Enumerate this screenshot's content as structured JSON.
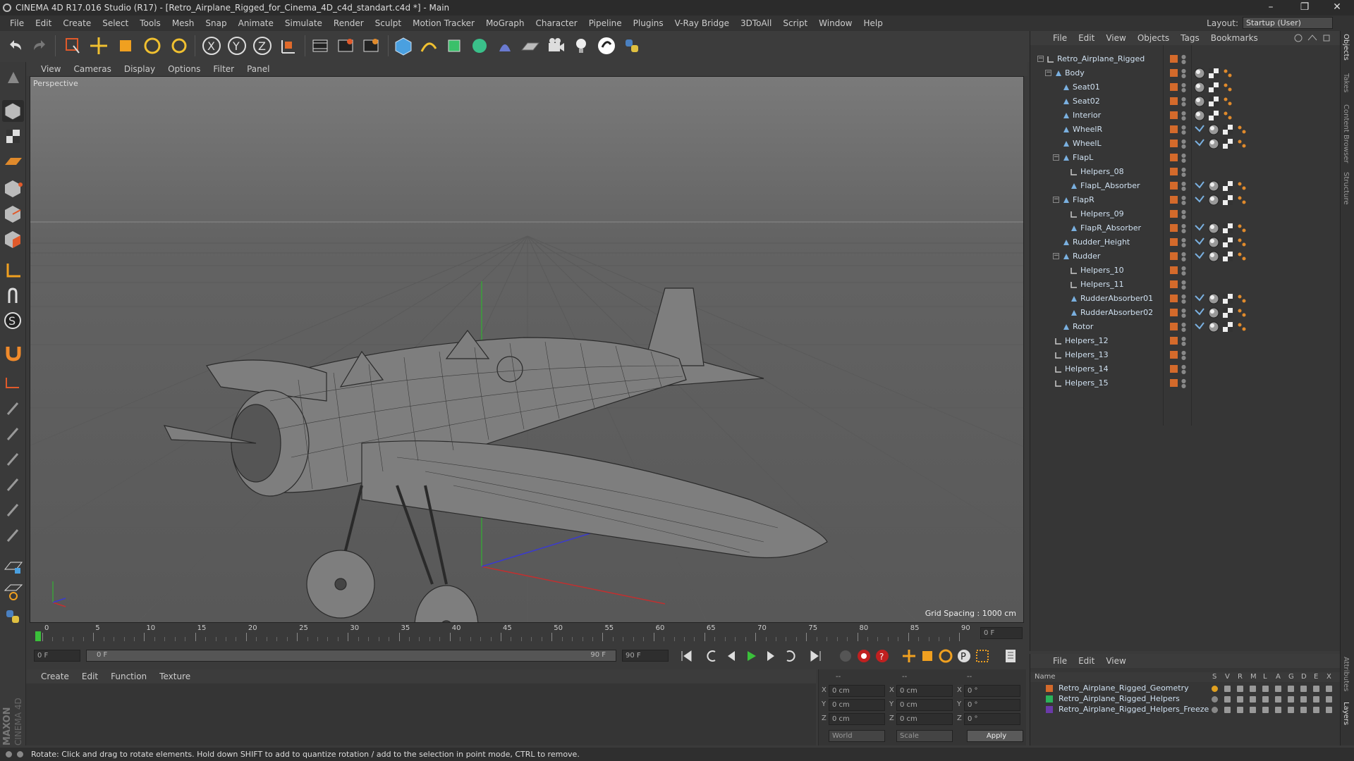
{
  "window": {
    "title": "CINEMA 4D R17.016 Studio (R17) - [Retro_Airplane_Rigged_for_Cinema_4D_c4d_standart.c4d *] - Main",
    "controls": [
      "–",
      "❐",
      "✕"
    ]
  },
  "menubar": [
    "File",
    "Edit",
    "Create",
    "Select",
    "Tools",
    "Mesh",
    "Snap",
    "Animate",
    "Simulate",
    "Render",
    "Sculpt",
    "Motion Tracker",
    "MoGraph",
    "Character",
    "Pipeline",
    "Plugins",
    "V-Ray Bridge",
    "3DToAll",
    "Script",
    "Window",
    "Help"
  ],
  "layout": {
    "label": "Layout:",
    "value": "Startup (User)"
  },
  "viewport": {
    "menu": [
      "View",
      "Cameras",
      "Display",
      "Options",
      "Filter",
      "Panel"
    ],
    "label": "Perspective",
    "grid_spacing": "Grid Spacing : 1000 cm"
  },
  "timeline": {
    "ticks": [
      "0",
      "5",
      "10",
      "15",
      "20",
      "25",
      "30",
      "35",
      "40",
      "45",
      "50",
      "55",
      "60",
      "65",
      "70",
      "75",
      "80",
      "85",
      "90"
    ],
    "end_field": "0 F",
    "start_field": "0 F",
    "range_start": "0 F",
    "range_end": "90 F",
    "max_field": "90 F"
  },
  "material_menu": [
    "Create",
    "Edit",
    "Function",
    "Texture"
  ],
  "coords": {
    "header": [
      "--",
      "--",
      "--"
    ],
    "rows": [
      {
        "axis": "X",
        "pos": "0 cm",
        "axis2": "X",
        "size": "0 cm",
        "axis3": "X",
        "rot": "0 °"
      },
      {
        "axis": "Y",
        "pos": "0 cm",
        "axis2": "Y",
        "size": "0 cm",
        "axis3": "Y",
        "rot": "0 °"
      },
      {
        "axis": "Z",
        "pos": "0 cm",
        "axis2": "Z",
        "size": "0 cm",
        "axis3": "Z",
        "rot": "0 °"
      }
    ],
    "world": "World",
    "scale": "Scale",
    "apply": "Apply"
  },
  "object_menu": [
    "File",
    "Edit",
    "View",
    "Objects",
    "Tags",
    "Bookmarks"
  ],
  "objects": [
    {
      "name": "Retro_Airplane_Rigged",
      "depth": 0,
      "type": "null",
      "tags": 0
    },
    {
      "name": "Body",
      "depth": 1,
      "type": "joint",
      "tags": 3
    },
    {
      "name": "Seat01",
      "depth": 2,
      "type": "joint",
      "tags": 3
    },
    {
      "name": "Seat02",
      "depth": 2,
      "type": "joint",
      "tags": 3
    },
    {
      "name": "Interior",
      "depth": 2,
      "type": "joint",
      "tags": 3
    },
    {
      "name": "WheelR",
      "depth": 2,
      "type": "joint",
      "tags": 4
    },
    {
      "name": "WheelL",
      "depth": 2,
      "type": "joint",
      "tags": 4
    },
    {
      "name": "FlapL",
      "depth": 2,
      "type": "joint",
      "tags": 0
    },
    {
      "name": "Helpers_08",
      "depth": 3,
      "type": "null",
      "tags": 0
    },
    {
      "name": "FlapL_Absorber",
      "depth": 3,
      "type": "joint",
      "tags": 4
    },
    {
      "name": "FlapR",
      "depth": 2,
      "type": "joint",
      "tags": 4
    },
    {
      "name": "Helpers_09",
      "depth": 3,
      "type": "null",
      "tags": 0
    },
    {
      "name": "FlapR_Absorber",
      "depth": 3,
      "type": "joint",
      "tags": 4
    },
    {
      "name": "Rudder_Height",
      "depth": 2,
      "type": "joint",
      "tags": 4
    },
    {
      "name": "Rudder",
      "depth": 2,
      "type": "joint",
      "tags": 4
    },
    {
      "name": "Helpers_10",
      "depth": 3,
      "type": "null",
      "tags": 0
    },
    {
      "name": "Helpers_11",
      "depth": 3,
      "type": "null",
      "tags": 0
    },
    {
      "name": "RudderAbsorber01",
      "depth": 3,
      "type": "joint",
      "tags": 4
    },
    {
      "name": "RudderAbsorber02",
      "depth": 3,
      "type": "joint",
      "tags": 4
    },
    {
      "name": "Rotor",
      "depth": 2,
      "type": "joint",
      "tags": 4
    },
    {
      "name": "Helpers_12",
      "depth": 1,
      "type": "null",
      "tags": 0
    },
    {
      "name": "Helpers_13",
      "depth": 1,
      "type": "null",
      "tags": 0
    },
    {
      "name": "Helpers_14",
      "depth": 1,
      "type": "null",
      "tags": 0
    },
    {
      "name": "Helpers_15",
      "depth": 1,
      "type": "null",
      "tags": 0
    }
  ],
  "layer_menu": [
    "File",
    "Edit",
    "View"
  ],
  "layers": {
    "header": {
      "name": "Name",
      "cols": [
        "S",
        "V",
        "R",
        "M",
        "L",
        "A",
        "G",
        "D",
        "E",
        "X"
      ]
    },
    "rows": [
      {
        "name": "Retro_Airplane_Rigged_Geometry",
        "color": "#d46a2b"
      },
      {
        "name": "Retro_Airplane_Rigged_Helpers",
        "color": "#2bb35a"
      },
      {
        "name": "Retro_Airplane_Rigged_Helpers_Freeze",
        "color": "#6a3aa8"
      }
    ]
  },
  "right_tabs": [
    "Objects",
    "Takes",
    "Content Browser",
    "Structure"
  ],
  "right_tabs_bottom": [
    "Attributes",
    "Layers"
  ],
  "brand": "MAXON CINEMA 4D",
  "status": "Rotate: Click and drag to rotate elements. Hold down SHIFT to add to quantize rotation / add to the selection in point mode, CTRL to remove."
}
